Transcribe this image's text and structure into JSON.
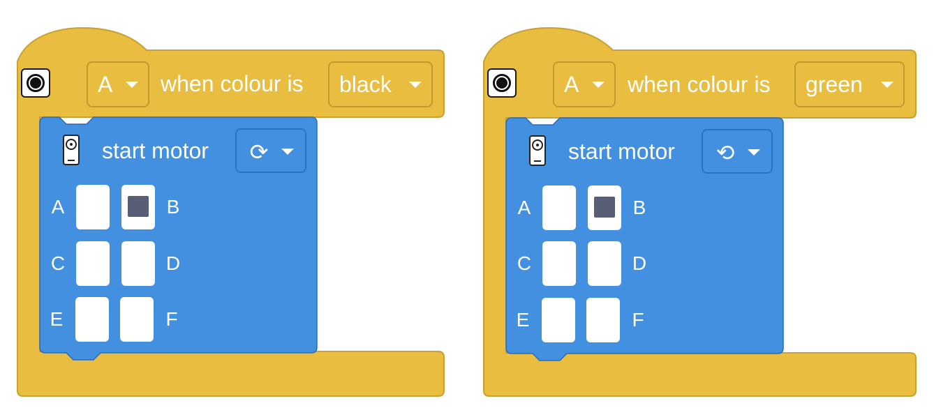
{
  "blocks": [
    {
      "hat": {
        "icon": "color-sensor-icon",
        "port": "A",
        "label": "when colour is",
        "colour": "black"
      },
      "stack": {
        "icon": "motor-icon",
        "label": "start motor",
        "direction": {
          "icon": "clockwise-icon",
          "glyph": "⟳"
        },
        "ports": [
          {
            "letter": "A",
            "selected": false
          },
          {
            "letter": "B",
            "selected": true
          },
          {
            "letter": "C",
            "selected": false
          },
          {
            "letter": "D",
            "selected": false
          },
          {
            "letter": "E",
            "selected": false
          },
          {
            "letter": "F",
            "selected": false
          }
        ]
      }
    },
    {
      "hat": {
        "icon": "color-sensor-icon",
        "port": "A",
        "label": "when colour is",
        "colour": "green"
      },
      "stack": {
        "icon": "motor-icon",
        "label": "start motor",
        "direction": {
          "icon": "counterclockwise-icon",
          "glyph": "⟲"
        },
        "ports": [
          {
            "letter": "A",
            "selected": false
          },
          {
            "letter": "B",
            "selected": true
          },
          {
            "letter": "C",
            "selected": false
          },
          {
            "letter": "D",
            "selected": false
          },
          {
            "letter": "E",
            "selected": false
          },
          {
            "letter": "F",
            "selected": false
          }
        ]
      }
    }
  ],
  "colors": {
    "hat_fill": "#e9bd40",
    "hat_stroke": "#c9a032",
    "stack_fill": "#4490e0",
    "stack_stroke": "#2d6cb3",
    "selected_port": "#575e75"
  }
}
